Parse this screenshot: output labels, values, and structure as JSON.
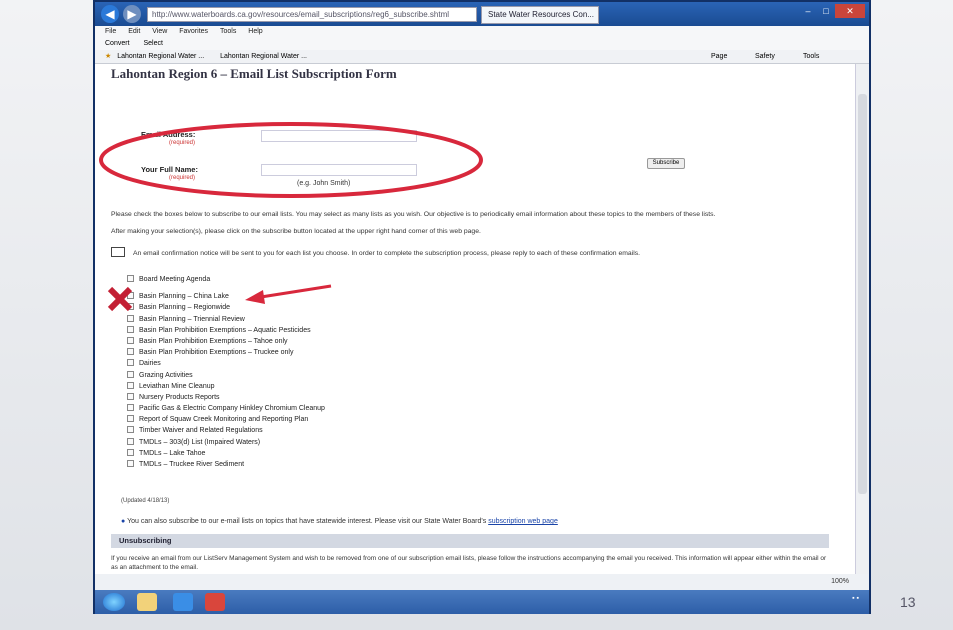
{
  "browser": {
    "address": "http://www.waterboards.ca.gov/resources/email_subscriptions/reg6_subscribe.shtml",
    "tab_title": "State Water Resources Con...",
    "menu": [
      "File",
      "Edit",
      "View",
      "Favorites",
      "Tools",
      "Help"
    ],
    "convert_label": "Convert",
    "select_label": "Select",
    "favorites": [
      "Lahontan Regional Water ...",
      "Lahontan Regional Water ..."
    ],
    "command_right": [
      "Page",
      "Safety",
      "Tools"
    ],
    "zoom": "100%"
  },
  "page": {
    "title": "Lahontan Region 6 – Email List Subscription Form",
    "email_label": "Email Address:",
    "name_label": "Your Full Name:",
    "required": "(required)",
    "name_hint": "(e.g. John Smith)",
    "subscribe_button": "Subscribe",
    "instruction_1": "Please check the boxes below to subscribe to our email lists. You may select as many lists as you wish. Our objective is to periodically email information about these topics to the members of these lists.",
    "instruction_2": "After making your selection(s), please click on the subscribe button located at the upper right hand corner of this web page.",
    "confirmation": "An email confirmation notice will be sent to you for each list you choose. In order to complete the subscription process, please reply to each of these confirmation emails.",
    "lists": [
      "Board Meeting Agenda",
      "Basin Planning – China Lake",
      "Basin Planning – Regionwide",
      "Basin Planning – Triennial Review",
      "Basin Plan Prohibition Exemptions – Aquatic Pesticides",
      "Basin Plan Prohibition Exemptions – Tahoe only",
      "Basin Plan Prohibition Exemptions – Truckee only",
      "Dairies",
      "Grazing Activities",
      "Leviathan Mine Cleanup",
      "Nursery Products Reports",
      "Pacific Gas & Electric Company Hinkley Chromium Cleanup",
      "Report of Squaw Creek Monitoring and Reporting Plan",
      "Timber Waiver and Related Regulations",
      "TMDLs – 303(d) List (Impaired Waters)",
      "TMDLs – Lake Tahoe",
      "TMDLs – Truckee River Sediment"
    ],
    "updated": "(Updated 4/18/13)",
    "also_text": "You can also subscribe to our e-mail lists on topics that have statewide interest. Please visit our State Water Board's",
    "also_link": "subscription web page",
    "unsubscribing": "Unsubscribing",
    "unsub_text": "If you receive an email from our ListServ Management System and wish to be removed from one of our subscription email lists, please follow the instructions accompanying the email you received. This information will appear either within the email or as an attachment to the email."
  },
  "slide_number": "13",
  "annotation_color": "#d8283c"
}
